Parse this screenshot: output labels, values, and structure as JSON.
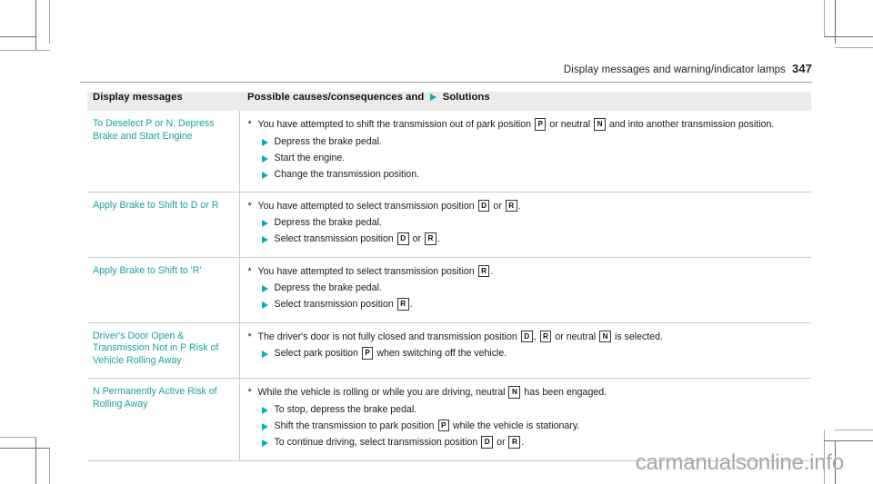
{
  "runhead": {
    "title": "Display messages and warning/indicator lamps",
    "page_number": "347"
  },
  "table": {
    "headers": {
      "col1": "Display messages",
      "col2_before": "Possible causes/consequences and",
      "col2_after": "Solutions"
    },
    "rows": [
      {
        "message": "To Deselect P or N, Depress Brake and Start Engine",
        "cause_marker": "*",
        "cause_parts": [
          {
            "t": "text",
            "v": "You have attempted to shift the transmission out of park position "
          },
          {
            "t": "badge",
            "v": "P"
          },
          {
            "t": "text",
            "v": " or neutral "
          },
          {
            "t": "badge",
            "v": "N"
          },
          {
            "t": "text",
            "v": " and into another transmission position."
          }
        ],
        "solutions": [
          [
            {
              "t": "text",
              "v": "Depress the brake pedal."
            }
          ],
          [
            {
              "t": "text",
              "v": "Start the engine."
            }
          ],
          [
            {
              "t": "text",
              "v": "Change the transmission position."
            }
          ]
        ]
      },
      {
        "message": "Apply Brake to Shift to D or R",
        "cause_marker": "*",
        "cause_parts": [
          {
            "t": "text",
            "v": "You have attempted to select transmission position "
          },
          {
            "t": "badge",
            "v": "D"
          },
          {
            "t": "text",
            "v": " or "
          },
          {
            "t": "badge",
            "v": "R"
          },
          {
            "t": "text",
            "v": "."
          }
        ],
        "solutions": [
          [
            {
              "t": "text",
              "v": "Depress the brake pedal."
            }
          ],
          [
            {
              "t": "text",
              "v": "Select transmission position "
            },
            {
              "t": "badge",
              "v": "D"
            },
            {
              "t": "text",
              "v": " or "
            },
            {
              "t": "badge",
              "v": "R"
            },
            {
              "t": "text",
              "v": "."
            }
          ]
        ]
      },
      {
        "message": "Apply Brake to Shift to 'R'",
        "cause_marker": "*",
        "cause_parts": [
          {
            "t": "text",
            "v": "You have attempted to select transmission position "
          },
          {
            "t": "badge",
            "v": "R"
          },
          {
            "t": "text",
            "v": "."
          }
        ],
        "solutions": [
          [
            {
              "t": "text",
              "v": "Depress the brake pedal."
            }
          ],
          [
            {
              "t": "text",
              "v": "Select transmission position "
            },
            {
              "t": "badge",
              "v": "R"
            },
            {
              "t": "text",
              "v": "."
            }
          ]
        ]
      },
      {
        "message": "Driver's Door Open & Transmission Not in P Risk of Vehicle Rolling Away",
        "cause_marker": "*",
        "cause_parts": [
          {
            "t": "text",
            "v": "The driver's door is not fully closed and transmission position "
          },
          {
            "t": "badge",
            "v": "D"
          },
          {
            "t": "text",
            "v": ", "
          },
          {
            "t": "badge",
            "v": "R"
          },
          {
            "t": "text",
            "v": " or neutral "
          },
          {
            "t": "badge",
            "v": "N"
          },
          {
            "t": "text",
            "v": " is selected."
          }
        ],
        "solutions": [
          [
            {
              "t": "text",
              "v": "Select park position "
            },
            {
              "t": "badge",
              "v": "P"
            },
            {
              "t": "text",
              "v": " when switching off the vehicle."
            }
          ]
        ]
      },
      {
        "message": "N Permanently Active Risk of Rolling Away",
        "cause_marker": "*",
        "cause_parts": [
          {
            "t": "text",
            "v": "While the vehicle is rolling or while you are driving, neutral "
          },
          {
            "t": "badge",
            "v": "N"
          },
          {
            "t": "text",
            "v": " has been engaged."
          }
        ],
        "solutions": [
          [
            {
              "t": "text",
              "v": "To stop, depress the brake pedal."
            }
          ],
          [
            {
              "t": "text",
              "v": "Shift the transmission to park position "
            },
            {
              "t": "badge",
              "v": "P"
            },
            {
              "t": "text",
              "v": " while the vehicle is stationary."
            }
          ],
          [
            {
              "t": "text",
              "v": "To continue driving, select transmission position "
            },
            {
              "t": "badge",
              "v": "D"
            },
            {
              "t": "text",
              "v": " or "
            },
            {
              "t": "badge",
              "v": "R"
            },
            {
              "t": "text",
              "v": "."
            }
          ]
        ]
      }
    ]
  },
  "watermark": "carmanualsonline.info",
  "colors": {
    "accent_teal": "#17a3a3",
    "bullet_teal": "#00b3b3",
    "header_bg": "#ebebeb",
    "rule": "#9aa6a4",
    "border": "#c9c9c9"
  }
}
